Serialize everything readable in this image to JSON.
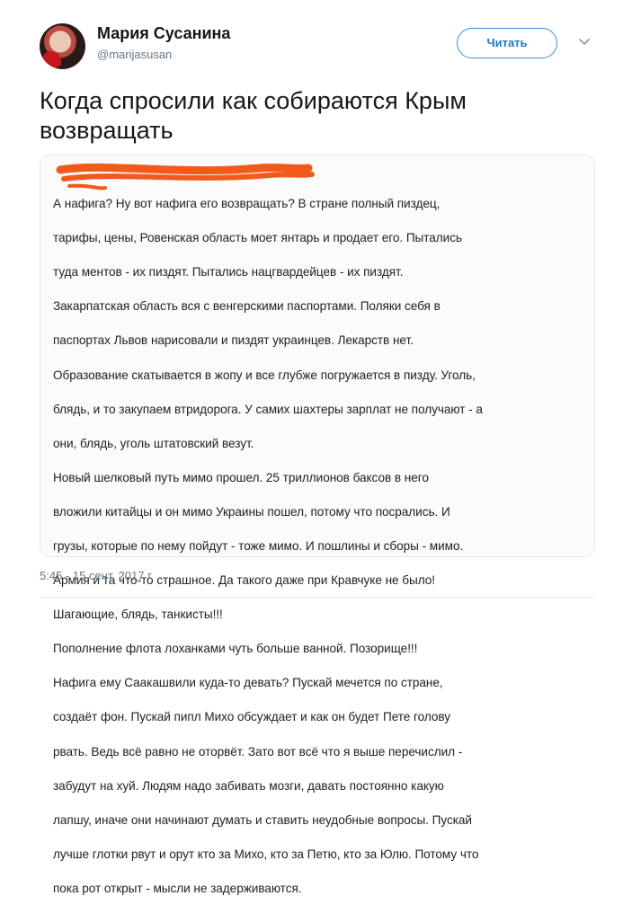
{
  "author": {
    "name": "Мария Сусанина",
    "handle": "@marijasusan"
  },
  "follow_button": {
    "label": "Читать"
  },
  "tweet": {
    "text": "Когда спросили как собираются Крым возвращать",
    "timestamp": "5:45 - 15 сент. 2017 г."
  },
  "media": {
    "lines": [
      "А нафига? Ну вот нафига его возвращать? В стране полный пиздец,",
      "тарифы, цены, Ровенская область моет янтарь и продает его. Пытались",
      "туда ментов - их пиздят. Пытались нацгвардейцев - их пиздят.",
      "Закарпатская область вся с венгерскими паспортами. Поляки себя в",
      "паспортах Львов нарисовали и пиздят украинцев. Лекарств нет.",
      "Образование скатывается в жопу и все глубже погружается в пизду. Уголь,",
      "блядь, и то закупаем втридорога. У самих шахтеры зарплат не получают - а",
      "они, блядь, уголь штатовский везут.",
      "Новый шелковый путь мимо прошел. 25 триллионов баксов в него",
      "вложили китайцы и он мимо Украины пошел, потому что посрались. И",
      "грузы, которые по нему пойдут - тоже мимо. И пошлины и сборы - мимо.",
      "Армия и та что-то страшное. Да такого даже при Кравчуке не было!",
      "Шагающие, блядь, танкисты!!!",
      "Пополнение флота лоханками чуть больше ванной. Позорище!!!",
      "Нафига ему Саакашвили куда-то девать? Пускай мечется по стране,",
      "создаёт фон. Пускай пипл Михо обсуждает и как он будет Пете голову",
      "рвать. Ведь всё равно не оторвёт. Зато вот всё что я выше перечислил -",
      "забудут на хуй. Людям надо забивать мозги, давать постоянно какую",
      "лапшу, иначе они начинают думать и ставить неудобные вопросы. Пускай",
      "лучше глотки рвут и орут кто за Михо, кто за Петю, кто за Юлю. Потому что",
      "пока рот открыт - мысли не задерживаются."
    ]
  },
  "colors": {
    "accent": "#1b79c4",
    "scribble": "#f25a1c",
    "muted": "#657786"
  }
}
